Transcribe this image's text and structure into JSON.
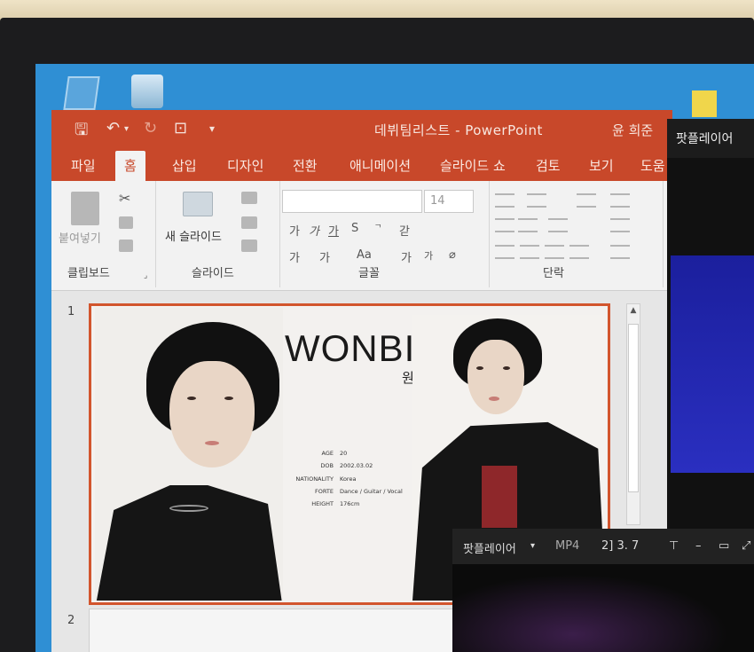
{
  "window": {
    "title": "데뷔팀리스트 - PowerPoint",
    "user": "윤 희준"
  },
  "ribbon_tabs": [
    "파일",
    "홈",
    "삽입",
    "디자인",
    "전환",
    "애니메이션",
    "슬라이드 쇼",
    "검토",
    "보기",
    "도움"
  ],
  "ribbon": {
    "paste_label": "붙여넣기",
    "new_slide_label": "새 슬라이드",
    "font_size": "14",
    "groups": {
      "clipboard": "클립보드",
      "slides": "슬라이드",
      "font": "글꼴",
      "paragraph": "단락"
    }
  },
  "slides": [
    {
      "number": "1",
      "name": "WONBIN",
      "name_korean": "원 빈",
      "profile": [
        {
          "label": "AGE",
          "value": "20"
        },
        {
          "label": "DOB",
          "value": "2002.03.02"
        },
        {
          "label": "NATIONALITY",
          "value": "Korea"
        },
        {
          "label": "FORTE",
          "value": "Dance / Guitar / Vocal"
        },
        {
          "label": "HEIGHT",
          "value": "176cm"
        }
      ]
    },
    {
      "number": "2"
    }
  ],
  "player_right": {
    "title": "팟플레이어"
  },
  "player_bottom": {
    "title": "팟플레이어",
    "format": "MP4",
    "info": "2] 3. 7"
  },
  "colors": {
    "ppt_accent": "#c8482a",
    "slide_border": "#d2552d",
    "desktop": "#2f8fd4"
  }
}
